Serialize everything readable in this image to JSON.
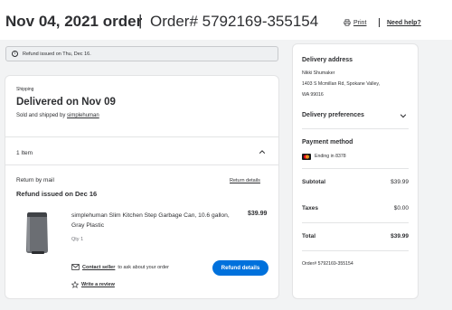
{
  "header": {
    "order_date": "Nov 04, 2021 order",
    "separator": "|",
    "order_number": "Order# 5792169-355154",
    "print_label": "Print",
    "help_label": "Need help?"
  },
  "banner": {
    "text": "Refund issued on Thu, Dec 16."
  },
  "shipment": {
    "type_label": "Shipping",
    "status": "Delivered on Nov 09",
    "sold_by_prefix": "Sold and shipped by ",
    "seller": "simplehuman",
    "items_count": "1 Item"
  },
  "return": {
    "method": "Return by mail",
    "details_link": "Return details",
    "refund_status": "Refund issued on Dec 16"
  },
  "product": {
    "name": "simplehuman Slim Kitchen Step Garbage Can, 10.6 gallon, Gray Plastic",
    "price": "$39.99",
    "quantity": "Qty 1",
    "contact_link": "Contact seller",
    "contact_suffix": "to ask about your order",
    "refund_details_button": "Refund details",
    "review_link": "Write a review"
  },
  "delivery": {
    "title": "Delivery address",
    "name": "Nikki Shumaker",
    "street": "1403 S Mcmillan Rd, Spokane Valley,",
    "city": "WA 99016",
    "preferences_label": "Delivery preferences"
  },
  "payment": {
    "title": "Payment method",
    "card_text": "Ending in 8378",
    "card_icon": "mastercard-icon"
  },
  "summary": {
    "subtotal_label": "Subtotal",
    "subtotal_value": "$39.99",
    "taxes_label": "Taxes",
    "taxes_value": "$0.00",
    "total_label": "Total",
    "total_value": "$39.99",
    "order_number": "Order# 5792169-355154"
  },
  "colors": {
    "accent": "#0071dc",
    "text": "#2e2f32",
    "page_bg": "#f2f3f4"
  }
}
